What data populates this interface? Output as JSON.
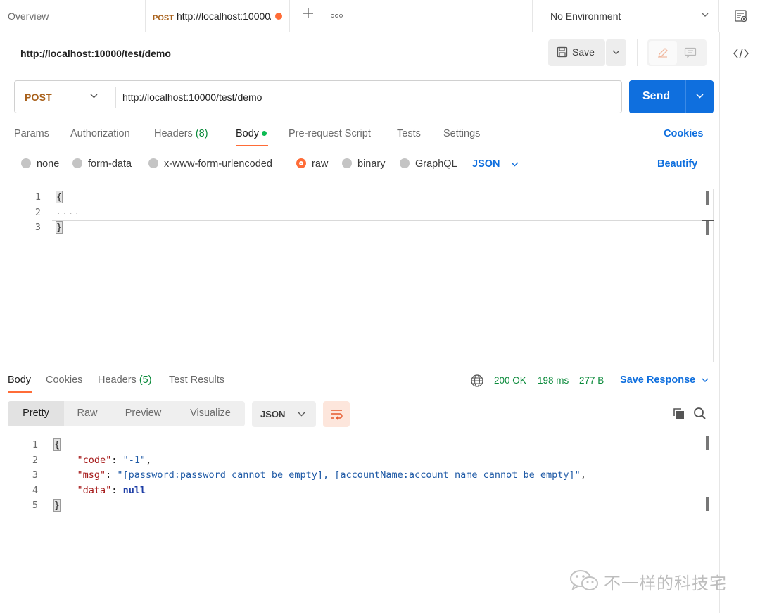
{
  "tabs": {
    "overview": "Overview",
    "active_method": "POST",
    "active_url": "http://localhost:10000/test/demo",
    "unsaved_dot_color": "#ff6c37"
  },
  "environment": {
    "selected": "No Environment"
  },
  "request": {
    "title": "http://localhost:10000/test/demo",
    "save_label": "Save",
    "method": "POST",
    "url": "http://localhost:10000/test/demo",
    "send_label": "Send"
  },
  "request_tabs": [
    {
      "label": "Params"
    },
    {
      "label": "Authorization"
    },
    {
      "label": "Headers",
      "count": "(8)"
    },
    {
      "label": "Body",
      "active": true
    },
    {
      "label": "Pre-request Script"
    },
    {
      "label": "Tests"
    },
    {
      "label": "Settings"
    }
  ],
  "cookies_link": "Cookies",
  "body_types": [
    {
      "label": "none"
    },
    {
      "label": "form-data"
    },
    {
      "label": "x-www-form-urlencoded"
    },
    {
      "label": "raw",
      "selected": true
    },
    {
      "label": "binary"
    },
    {
      "label": "GraphQL"
    }
  ],
  "raw_format": "JSON",
  "beautify_label": "Beautify",
  "request_body": {
    "lines": [
      "1",
      "2",
      "3"
    ],
    "line1": "{",
    "line2": "····",
    "line3": "}"
  },
  "response": {
    "tabs": [
      {
        "label": "Body",
        "active": true
      },
      {
        "label": "Cookies"
      },
      {
        "label": "Headers",
        "count": "(5)"
      },
      {
        "label": "Test Results"
      }
    ],
    "status": "200 OK",
    "time": "198 ms",
    "size": "277 B",
    "save_response": "Save Response",
    "views": [
      "Pretty",
      "Raw",
      "Preview",
      "Visualize"
    ],
    "format": "JSON",
    "line_numbers": [
      "1",
      "2",
      "3",
      "4",
      "5"
    ],
    "body": {
      "open": "{",
      "code_key": "\"code\"",
      "code_val": "\"-1\"",
      "msg_key": "\"msg\"",
      "msg_val": "\"[password:password cannot be empty], [accountName:account name cannot be empty]\"",
      "data_key": "\"data\"",
      "data_val": "null",
      "close": "}"
    }
  },
  "watermark": "不一样的科技宅",
  "colors": {
    "accent_orange": "#ff6c37",
    "link_blue": "#0f6fde",
    "send_blue": "#0f6fde",
    "method_post": "#a8601a",
    "status_green": "#0a8a3a"
  }
}
